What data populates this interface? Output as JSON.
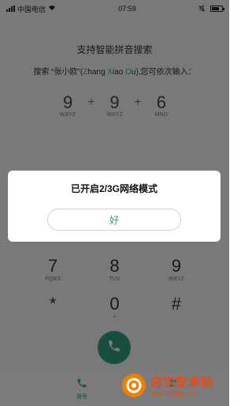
{
  "status_bar": {
    "carrier": "中国电信",
    "time": "07:59"
  },
  "tip": {
    "title": "支持智能拼音搜索",
    "line_prefix": "搜索 “张小欧”(",
    "z_hl": "Z",
    "z_rest": "hang ",
    "x_hl": "X",
    "x_rest": "iao ",
    "o_hl": "O",
    "line_suffix": "u),您可依次输入：",
    "keys": [
      {
        "num": "9",
        "letters": "WXYZ"
      },
      {
        "num": "9",
        "letters": "WXYZ"
      },
      {
        "num": "6",
        "letters": "MNO"
      }
    ],
    "plus": "+"
  },
  "dialpad": {
    "rows": [
      [
        {
          "num": "7",
          "letters": "PQRS"
        },
        {
          "num": "8",
          "letters": "TUV"
        },
        {
          "num": "9",
          "letters": "WXYZ"
        }
      ],
      [
        {
          "num": "*",
          "letters": ""
        },
        {
          "num": "0",
          "letters": "+"
        },
        {
          "num": "#",
          "letters": ""
        }
      ]
    ]
  },
  "bottom_nav": {
    "dial_label": "拨号"
  },
  "dialog": {
    "title": "已开启2/3G网络模式",
    "ok_label": "好"
  },
  "watermark": {
    "name": "启东安卓网",
    "url": "www.qdltdq.com"
  },
  "colors": {
    "accent": "#2f9c7e",
    "highlight": "#35b69a",
    "overlay": "rgba(0,0,0,0.5)"
  }
}
